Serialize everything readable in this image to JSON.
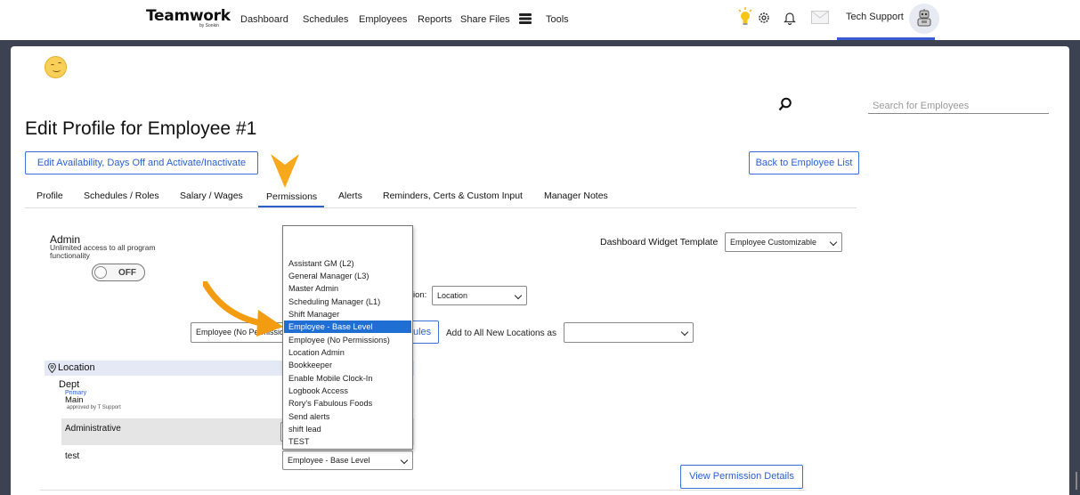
{
  "app": {
    "logo": "Teamwork",
    "logo_sub": "by Sonkin"
  },
  "nav": {
    "items": [
      "Dashboard",
      "Schedules",
      "Employees",
      "Reports",
      "Share Files",
      "Tools"
    ],
    "user": "Tech Support"
  },
  "search": {
    "placeholder": "Search for Employees"
  },
  "page": {
    "title": "Edit Profile for Employee #1",
    "btn_availability": "Edit Availability, Days Off and Activate/Inactivate",
    "btn_back": "Back to Employee List"
  },
  "tabs": [
    "Profile",
    "Schedules / Roles",
    "Salary / Wages",
    "Permissions",
    "Alerts",
    "Reminders, Certs & Custom Input",
    "Manager Notes"
  ],
  "active_tab": "Permissions",
  "admin": {
    "title": "Admin",
    "desc": "Unlimited access to all program functionality",
    "toggle": "OFF"
  },
  "dashboard_widget": {
    "label": "Dashboard Widget Template",
    "value": "Employee Customizable"
  },
  "location_filter": {
    "label_suffix": "ion:",
    "value": "Location"
  },
  "bulk": {
    "role_select": "Employee (No Permissions)",
    "apply_suffix": "ules",
    "add_all_label": "Add to All New Locations as",
    "add_all_value": ""
  },
  "location_section": {
    "header": "Location",
    "dept": "Dept",
    "primary": "Primary",
    "main": "Main",
    "approved": "approved by T Support",
    "rows": [
      "Administrative",
      "test"
    ],
    "test_select": "Employee - Base Level"
  },
  "dropdown": {
    "options": [
      "Assistant GM (L2)",
      "General Manager (L3)",
      "Master Admin",
      "Scheduling Manager (L1)",
      "Shift Manager",
      "Employee - Base Level",
      "Employee (No Permissions)",
      "Location Admin",
      "Bookkeeper",
      "Enable Mobile Clock-In",
      "Logbook Access",
      "Rory's Fabulous Foods",
      "Send alerts",
      "shift lead",
      "TEST"
    ],
    "selected": "Employee - Base Level"
  },
  "btn_view_permissions": "View Permission Details",
  "colors": {
    "accent": "#2a5fd0",
    "frame": "#3c4252",
    "arrow": "#f39c12",
    "selected_option": "#1f6ed4"
  }
}
